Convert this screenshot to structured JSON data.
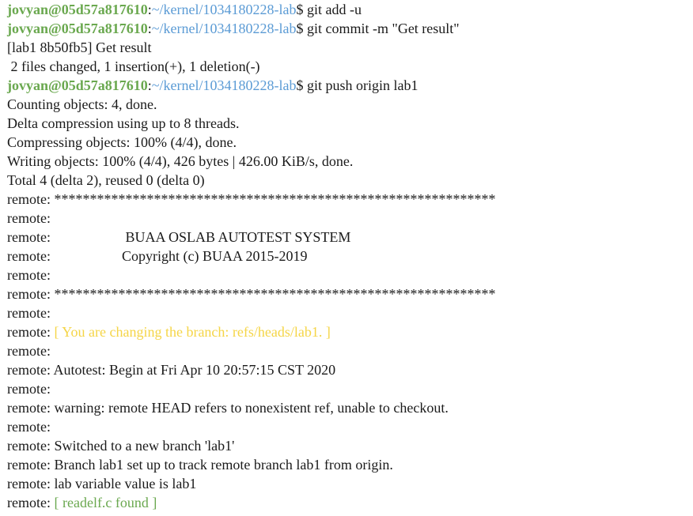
{
  "prompt": {
    "user_host": "jovyan@05d57a817610",
    "sep": ":",
    "path": "~/kernel/1034180228-lab",
    "dollar": "$"
  },
  "lines": [
    {
      "type": "cmd",
      "command": " git add -u"
    },
    {
      "type": "cmd",
      "command": " git commit -m \"Get result\""
    },
    {
      "type": "out",
      "text": "[lab1 8b50fb5] Get result"
    },
    {
      "type": "out",
      "text": " 2 files changed, 1 insertion(+), 1 deletion(-)"
    },
    {
      "type": "cmd",
      "command": " git push origin lab1"
    },
    {
      "type": "out",
      "text": "Counting objects: 4, done."
    },
    {
      "type": "out",
      "text": "Delta compression using up to 8 threads."
    },
    {
      "type": "out",
      "text": "Compressing objects: 100% (4/4), done."
    },
    {
      "type": "out",
      "text": "Writing objects: 100% (4/4), 426 bytes | 426.00 KiB/s, done."
    },
    {
      "type": "out",
      "text": "Total 4 (delta 2), reused 0 (delta 0)"
    },
    {
      "type": "remote",
      "text": "**************************************************************"
    },
    {
      "type": "remote",
      "text": ""
    },
    {
      "type": "remote",
      "text": "                    BUAA OSLAB AUTOTEST SYSTEM"
    },
    {
      "type": "remote",
      "text": "                   Copyright (c) BUAA 2015-2019"
    },
    {
      "type": "remote",
      "text": ""
    },
    {
      "type": "remote",
      "text": "**************************************************************"
    },
    {
      "type": "remote",
      "text": ""
    },
    {
      "type": "remote-color",
      "color": "yellow",
      "text": "[ You are changing the branch: refs/heads/lab1. ]"
    },
    {
      "type": "remote",
      "text": ""
    },
    {
      "type": "remote",
      "text": "Autotest: Begin at Fri Apr 10 20:57:15 CST 2020"
    },
    {
      "type": "remote",
      "text": ""
    },
    {
      "type": "remote",
      "text": "warning: remote HEAD refers to nonexistent ref, unable to checkout."
    },
    {
      "type": "remote",
      "text": ""
    },
    {
      "type": "remote",
      "text": "Switched to a new branch 'lab1'"
    },
    {
      "type": "remote",
      "text": "Branch lab1 set up to track remote branch lab1 from origin."
    },
    {
      "type": "remote",
      "text": "lab variable value is lab1"
    },
    {
      "type": "remote-color",
      "color": "green",
      "text": "[ readelf.c found ]"
    }
  ],
  "remote_prefix": "remote: ",
  "colors": {
    "user": "#6aa84f",
    "path": "#5b9bd5",
    "yellow": "#f5d547",
    "green": "#6aa84f",
    "text": "#1a1a1a"
  }
}
